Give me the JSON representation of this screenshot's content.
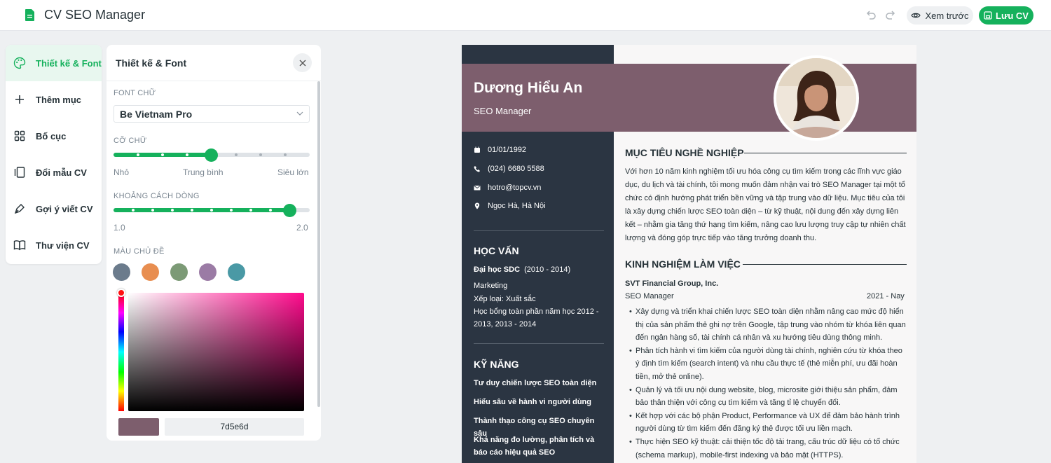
{
  "app": {
    "title": "CV SEO Manager"
  },
  "toolbar": {
    "preview_label": "Xem trước",
    "save_label": "Lưu CV"
  },
  "nav": {
    "items": [
      {
        "label": "Thiết kế & Font",
        "icon": "palette-icon",
        "active": true
      },
      {
        "label": "Thêm mục",
        "icon": "plus-icon"
      },
      {
        "label": "Bố cục",
        "icon": "grid-icon"
      },
      {
        "label": "Đổi mẫu CV",
        "icon": "template-icon"
      },
      {
        "label": "Gợi ý viết CV",
        "icon": "pen-icon"
      },
      {
        "label": "Thư viện CV",
        "icon": "book-icon"
      }
    ]
  },
  "panel": {
    "title": "Thiết kế & Font",
    "font_label": "FONT CHỮ",
    "font_value": "Be Vietnam Pro",
    "size_label": "CỠ CHỮ",
    "size_min_label": "Nhỏ",
    "size_mid_label": "Trung bình",
    "size_max_label": "Siêu lớn",
    "size_level": 0.5,
    "line_label": "KHOẢNG CÁCH DÒNG",
    "line_min": "1.0",
    "line_max": "2.0",
    "line_level": 0.9,
    "color_label": "MÀU CHỦ ĐỀ",
    "swatches": [
      "#6b7b8c",
      "#e88e50",
      "#7c9a76",
      "#9b7ba5",
      "#4a99a5"
    ],
    "hex_value": "7d5e6d",
    "selected_color": "#7d5e6d"
  },
  "cv": {
    "name": "Dương Hiểu An",
    "role": "SEO Manager",
    "accent": "#7d5e6d",
    "contact": [
      {
        "icon": "calendar-icon",
        "text": "01/01/1992"
      },
      {
        "icon": "phone-icon",
        "text": "(024) 6680 5588"
      },
      {
        "icon": "mail-icon",
        "text": "hotro@topcv.vn"
      },
      {
        "icon": "location-icon",
        "text": "Ngọc Hà, Hà Nội"
      }
    ],
    "education": {
      "heading": "HỌC VẤN",
      "school": "Đại học SDC",
      "years": "(2010 - 2014)",
      "major": "Marketing",
      "rank": "Xếp loại: Xuất sắc",
      "scholarship": "Học bổng toàn phần năm học 2012 - 2013, 2013 - 2014"
    },
    "skills": {
      "heading": "KỸ NĂNG",
      "items": [
        "Tư duy chiến lược SEO toàn diện",
        "Hiểu sâu về hành vi người dùng",
        "Thành thạo công cụ SEO chuyên sâu",
        "Khả năng đo lường, phân tích và báo cáo hiệu quả SEO"
      ]
    },
    "objective": {
      "heading": "MỤC TIÊU NGHỀ NGHIỆP",
      "text": "Với hơn 10 năm kinh nghiệm tối ưu hóa công cụ tìm kiếm trong các lĩnh vực giáo dục, du lịch và tài chính, tôi mong muốn đảm nhận vai trò SEO Manager tại một tổ chức có định hướng phát triển bền vững và tập trung vào dữ liệu. Mục tiêu của tôi là xây dựng chiến lược SEO toàn diện – từ kỹ thuật, nội dung đến xây dựng liên kết – nhằm gia tăng thứ hạng tìm kiếm, nâng cao lưu lượng truy cập tự nhiên chất lượng và đóng góp trực tiếp vào tăng trưởng doanh thu."
    },
    "experience": {
      "heading": "KINH NGHIỆM LÀM VIỆC",
      "company": "SVT Financial Group, Inc.",
      "position": "SEO Manager",
      "period": "2021 - Nay",
      "bullets": [
        "Xây dựng và triển khai chiến lược SEO toàn diện nhằm nâng cao mức độ hiển thị của sản phẩm thẻ ghi nợ trên Google, tập trung vào nhóm từ khóa liên quan đến ngân hàng số, tài chính cá nhân và xu hướng tiêu dùng thông minh.",
        "Phân tích hành vi tìm kiếm của người dùng tài chính, nghiên cứu từ khóa theo ý định tìm kiếm (search intent) và nhu cầu thực tế (thẻ miễn phí, ưu đãi hoàn tiền, mở thẻ online).",
        "Quản lý và tối ưu nội dung website, blog, microsite giới thiệu sản phẩm, đảm bảo thân thiện với công cụ tìm kiếm và tăng tỉ lệ chuyển đổi.",
        "Kết hợp với các bộ phận Product, Performance và UX để đảm bảo hành trình người dùng từ tìm kiếm đến đăng ký thẻ được tối ưu liền mạch.",
        "Thực hiện SEO kỹ thuật: cải thiện tốc độ tải trang, cấu trúc dữ liệu có tổ chức (schema markup), mobile-first indexing và bảo mật (HTTPS)."
      ]
    }
  }
}
